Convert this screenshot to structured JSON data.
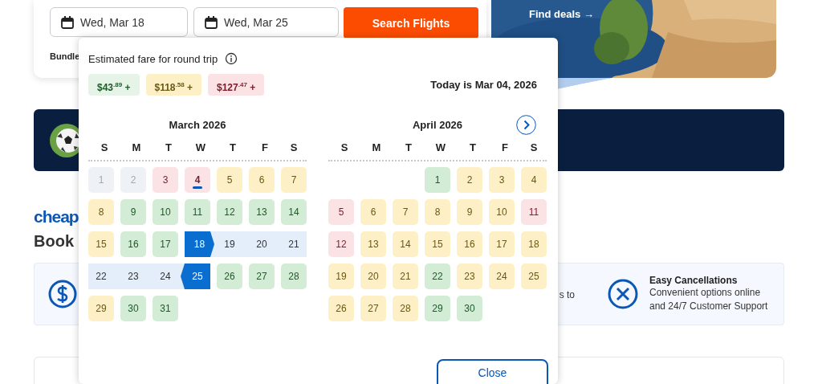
{
  "search": {
    "depart": "Wed, Mar 18",
    "return": "Wed, Mar 25",
    "button": "Search Flights",
    "bundle": "Bundle"
  },
  "deal": {
    "link": "Find deals →",
    "kind": "picture"
  },
  "logo": "cheap",
  "heading": "Book",
  "benefits": {
    "partial_text": "s to",
    "title": "Easy Cancellations",
    "description": "Convenient options online and 24/7 Customer Support"
  },
  "fare_popup": {
    "title": "Estimated fare for round trip",
    "legend": [
      {
        "price": "$43$^{.89}$ +",
        "color": "#e5f4e7"
      },
      {
        "price": "$118$^{.58}$ +",
        "color": "#fdf0c6"
      },
      {
        "price": "$127$^{.47}$ +",
        "color": "#fbe2e4"
      }
    ],
    "today": "Today is Mar 04, 2026",
    "months": [
      {
        "title": "March 2026",
        "weekdays": [
          "S",
          "M",
          "T",
          "W",
          "T",
          "F",
          "S"
        ],
        "weeks": [
          [
            {
              "day": "1",
              "disabled": true
            },
            {
              "day": "2",
              "disabled": true
            },
            {
              "day": "3",
              "color": "#fbe2e4"
            },
            {
              "day": "4",
              "color": "#fbe2e4",
              "today": true
            },
            {
              "day": "5",
              "color": "#fdf0c6"
            },
            {
              "day": "6",
              "color": "#fdf0c6"
            },
            {
              "day": "7",
              "color": "#fdf0c6"
            }
          ],
          [
            {
              "day": "8",
              "color": "#fdf0c6"
            },
            {
              "day": "9",
              "color": "#d3ecd5"
            },
            {
              "day": "10",
              "color": "#d3ecd5"
            },
            {
              "day": "11",
              "color": "#d3ecd5"
            },
            {
              "day": "12",
              "color": "#d3ecd5"
            },
            {
              "day": "13",
              "color": "#d3ecd5"
            },
            {
              "day": "14",
              "color": "#d3ecd5"
            }
          ],
          [
            {
              "day": "15",
              "color": "#fdf0c6"
            },
            {
              "day": "16",
              "color": "#d3ecd5"
            },
            {
              "day": "17",
              "color": "#d3ecd5"
            },
            {
              "day": "18",
              "selected": true,
              "range_start": true
            },
            {
              "day": "19",
              "in_range": true
            },
            {
              "day": "20",
              "in_range": true
            },
            {
              "day": "21",
              "in_range": true
            }
          ],
          [
            {
              "day": "22",
              "in_range": true
            },
            {
              "day": "23",
              "in_range": true
            },
            {
              "day": "24",
              "in_range": true
            },
            {
              "day": "25",
              "selected": true,
              "range_start": false
            },
            {
              "day": "26",
              "color": "#d3ecd5"
            },
            {
              "day": "27",
              "color": "#d3ecd5"
            },
            {
              "day": "28",
              "color": "#d3ecd5"
            }
          ],
          [
            {
              "day": "29",
              "color": "#fdf0c6"
            },
            {
              "day": "30",
              "color": "#d3ecd5"
            },
            {
              "day": "31",
              "color": "#d3ecd5"
            }
          ]
        ]
      },
      {
        "title": "April 2026",
        "weekdays": [
          "S",
          "M",
          "T",
          "W",
          "T",
          "F",
          "S"
        ],
        "next_button": true,
        "weeks": [
          [
            {
              "day": "1",
              "color": "#d3ecd5"
            },
            {
              "day": "2",
              "color": "#fdf0c6"
            },
            {
              "day": "3",
              "color": "#fdf0c6"
            },
            {
              "day": "4",
              "color": "#fdf0c6"
            }
          ],
          [
            {
              "day": "5",
              "color": "#fbe2e4"
            },
            {
              "day": "6",
              "color": "#fdf0c6"
            },
            {
              "day": "7",
              "color": "#fdf0c6"
            },
            {
              "day": "8",
              "color": "#fdf0c6"
            },
            {
              "day": "9",
              "color": "#fdf0c6"
            },
            {
              "day": "10",
              "color": "#fdf0c6"
            },
            {
              "day": "11",
              "color": "#fbe2e4"
            }
          ],
          [
            {
              "day": "12",
              "color": "#fbe2e4"
            },
            {
              "day": "13",
              "color": "#fdf0c6"
            },
            {
              "day": "14",
              "color": "#fdf0c6"
            },
            {
              "day": "15",
              "color": "#fdf0c6"
            },
            {
              "day": "16",
              "color": "#fdf0c6"
            },
            {
              "day": "17",
              "color": "#fdf0c6"
            },
            {
              "day": "18",
              "color": "#fdf0c6"
            }
          ],
          [
            {
              "day": "19",
              "color": "#fdf0c6"
            },
            {
              "day": "20",
              "color": "#fdf0c6"
            },
            {
              "day": "21",
              "color": "#fdf0c6"
            },
            {
              "day": "22",
              "color": "#d3ecd5"
            },
            {
              "day": "23",
              "color": "#fdf0c6"
            },
            {
              "day": "24",
              "color": "#fdf0c6"
            },
            {
              "day": "25",
              "color": "#fdf0c6"
            }
          ],
          [
            {
              "day": "26",
              "color": "#fdf0c6"
            },
            {
              "day": "27",
              "color": "#fdf0c6"
            },
            {
              "day": "28",
              "color": "#fdf0c6"
            },
            {
              "day": "29",
              "color": "#d3ecd5"
            },
            {
              "day": "30",
              "color": "#d3ecd5"
            }
          ]
        ]
      }
    ],
    "close_button": "Close"
  }
}
